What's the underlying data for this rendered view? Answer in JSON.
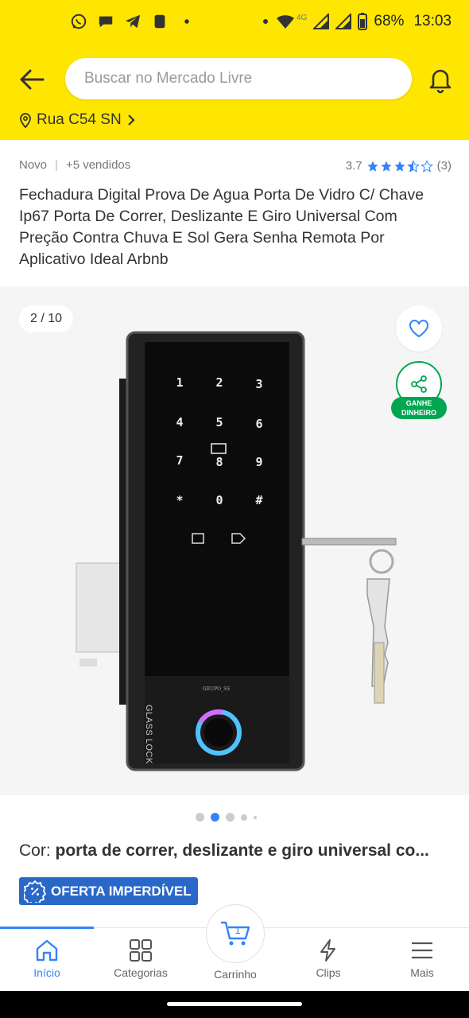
{
  "status_bar": {
    "network": "4G",
    "battery": "68%",
    "time": "13:03"
  },
  "header": {
    "search_placeholder": "Buscar no Mercado Livre",
    "address": "Rua C54 SN"
  },
  "product": {
    "condition": "Novo",
    "sold": "+5 vendidos",
    "rating": "3.7",
    "rating_value": 3.7,
    "reviews": "(3)",
    "title": "Fechadura Digital Prova De Agua Porta De Vidro C/ Chave Ip67 Porta De Correr, Deslizante E Giro Universal Com Preção Contra Chuva E Sol Gera Senha Remota Por Aplicativo Ideal Arbnb"
  },
  "gallery": {
    "counter": "2 / 10",
    "earn_label_1": "GANHE",
    "earn_label_2": "DINHEIRO",
    "keypad": [
      "1",
      "2",
      "3",
      "4",
      "5",
      "6",
      "7",
      "8",
      "9",
      "*",
      "0",
      "#"
    ],
    "brand_text": "GLASS LOCK",
    "watermark": "GRUPO_SS"
  },
  "variant": {
    "label": "Cor:",
    "value": "porta de correr, deslizante e giro universal co..."
  },
  "badge": {
    "offer": "OFERTA IMPERDÍVEL"
  },
  "nav": {
    "home": "Início",
    "categories": "Categorias",
    "cart": "Carrinho",
    "cart_count": "1",
    "clips": "Clips",
    "more": "Mais"
  },
  "colors": {
    "brand_yellow": "#ffe600",
    "accent_blue": "#3483fa",
    "earn_green": "#00a650"
  }
}
